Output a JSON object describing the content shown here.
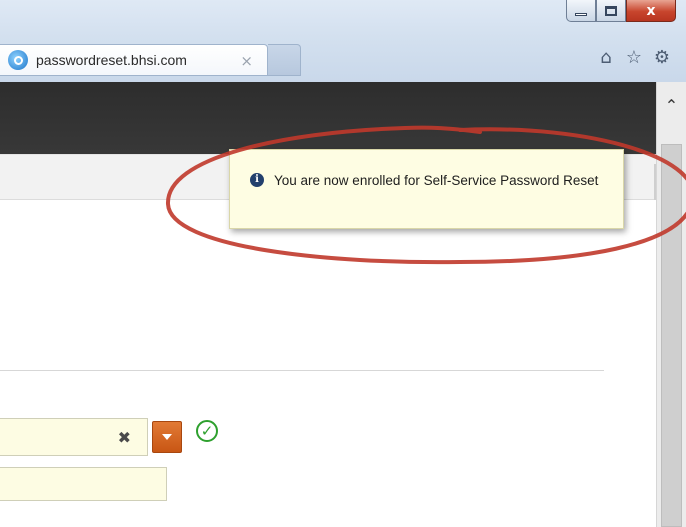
{
  "browser": {
    "tab_title": "passwordreset.bhsi.com",
    "tab_close_glyph": "×",
    "window_buttons": [
      "minimize",
      "maximize",
      "close"
    ],
    "toolbar_icons": [
      "home-icon",
      "favorites-star-icon",
      "settings-gear-icon"
    ]
  },
  "toast": {
    "icon": "info-icon",
    "message": "You are now enrolled for Self-Service Password Reset"
  },
  "form": {
    "combo_clear_glyph": "✖",
    "status_icon": "checkmark-circle-icon"
  },
  "annotation": {
    "color": "#c0392b",
    "shape": "ellipse"
  },
  "colors": {
    "toast_bg": "#fefde3",
    "dropdown_accent": "#d4631f",
    "success": "#2ea02e",
    "header_dark": "#333333"
  }
}
